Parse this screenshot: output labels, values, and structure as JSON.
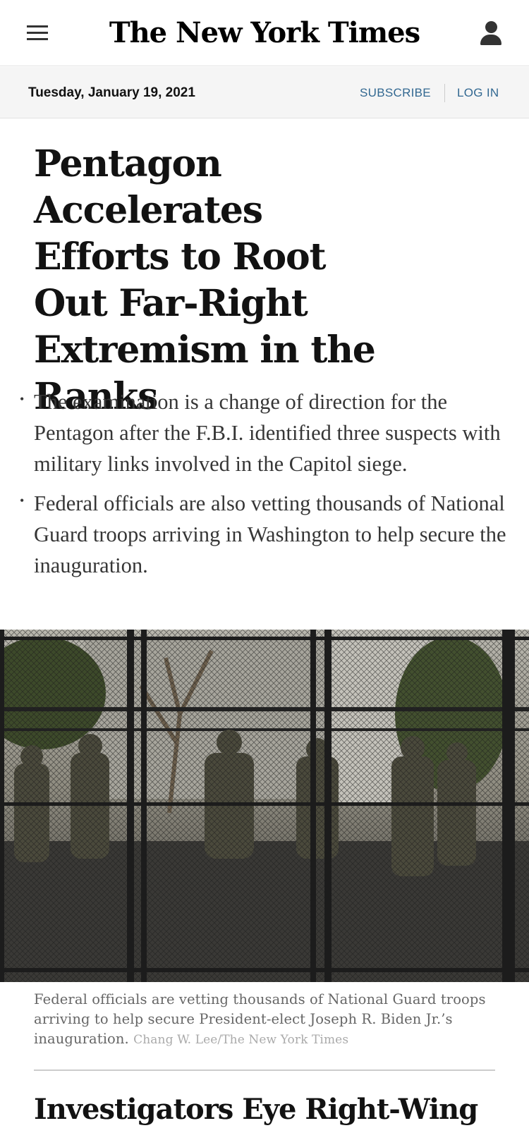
{
  "header": {
    "logo_text": "The New York Times",
    "menu_icon": "hamburger-menu-icon",
    "account_icon": "user-account-icon"
  },
  "datebar": {
    "date": "Tuesday, January 19, 2021",
    "subscribe_label": "SUBSCRIBE",
    "login_label": "LOG IN"
  },
  "article": {
    "headline": "Pentagon Accelerates Efforts to Root Out Far-Right Extremism in the Ranks",
    "summary": [
      "The examination is a change of direction for the Pentagon after the F.B.I. identified three suspects with military links involved in the Capitol siege.",
      "Federal officials are also vetting thousands of National Guard troops arriving in Washington to help secure the inauguration."
    ],
    "image": {
      "caption": "Federal officials are vetting thousands of National Guard troops arriving to help secure President-elect Joseph R. Biden Jr.’s inauguration.",
      "credit": "Chang W. Lee/The New York Times"
    }
  },
  "next_article": {
    "headline": "Investigators Eye Right-Wing"
  },
  "colors": {
    "link": "#326891",
    "datebar_bg": "#f5f5f5",
    "text": "#121212",
    "summary_text": "#363636"
  }
}
